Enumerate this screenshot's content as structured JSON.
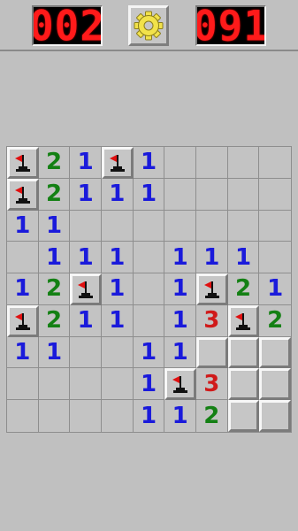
{
  "header": {
    "mines_remaining": "002",
    "timer": "091",
    "led_color": "#ff1a1a",
    "settings_icon": "gear-icon",
    "gear_color": "#f2e24a"
  },
  "board": {
    "rows": 9,
    "cols": 9,
    "legend": {
      "F": "flagged",
      "C": "covered",
      "E": "empty-revealed",
      "1-8": "revealed-number"
    },
    "number_colors": {
      "1": "#1a1adb",
      "2": "#148014",
      "3": "#d01a1a"
    },
    "cells": [
      [
        "F",
        "2",
        "1",
        "F",
        "1",
        "E",
        "E",
        "E",
        "E"
      ],
      [
        "F",
        "2",
        "1",
        "1",
        "1",
        "E",
        "E",
        "E",
        "E"
      ],
      [
        "1",
        "1",
        "E",
        "E",
        "E",
        "E",
        "E",
        "E",
        "E"
      ],
      [
        "E",
        "1",
        "1",
        "1",
        "E",
        "1",
        "1",
        "1",
        "E"
      ],
      [
        "1",
        "2",
        "F",
        "1",
        "E",
        "1",
        "F",
        "2",
        "1"
      ],
      [
        "F",
        "2",
        "1",
        "1",
        "E",
        "1",
        "3",
        "F",
        "2"
      ],
      [
        "1",
        "1",
        "E",
        "E",
        "1",
        "1",
        "C",
        "C",
        "C"
      ],
      [
        "E",
        "E",
        "E",
        "E",
        "1",
        "F",
        "3",
        "C",
        "C"
      ],
      [
        "E",
        "E",
        "E",
        "E",
        "1",
        "1",
        "2",
        "C",
        "C"
      ]
    ]
  }
}
